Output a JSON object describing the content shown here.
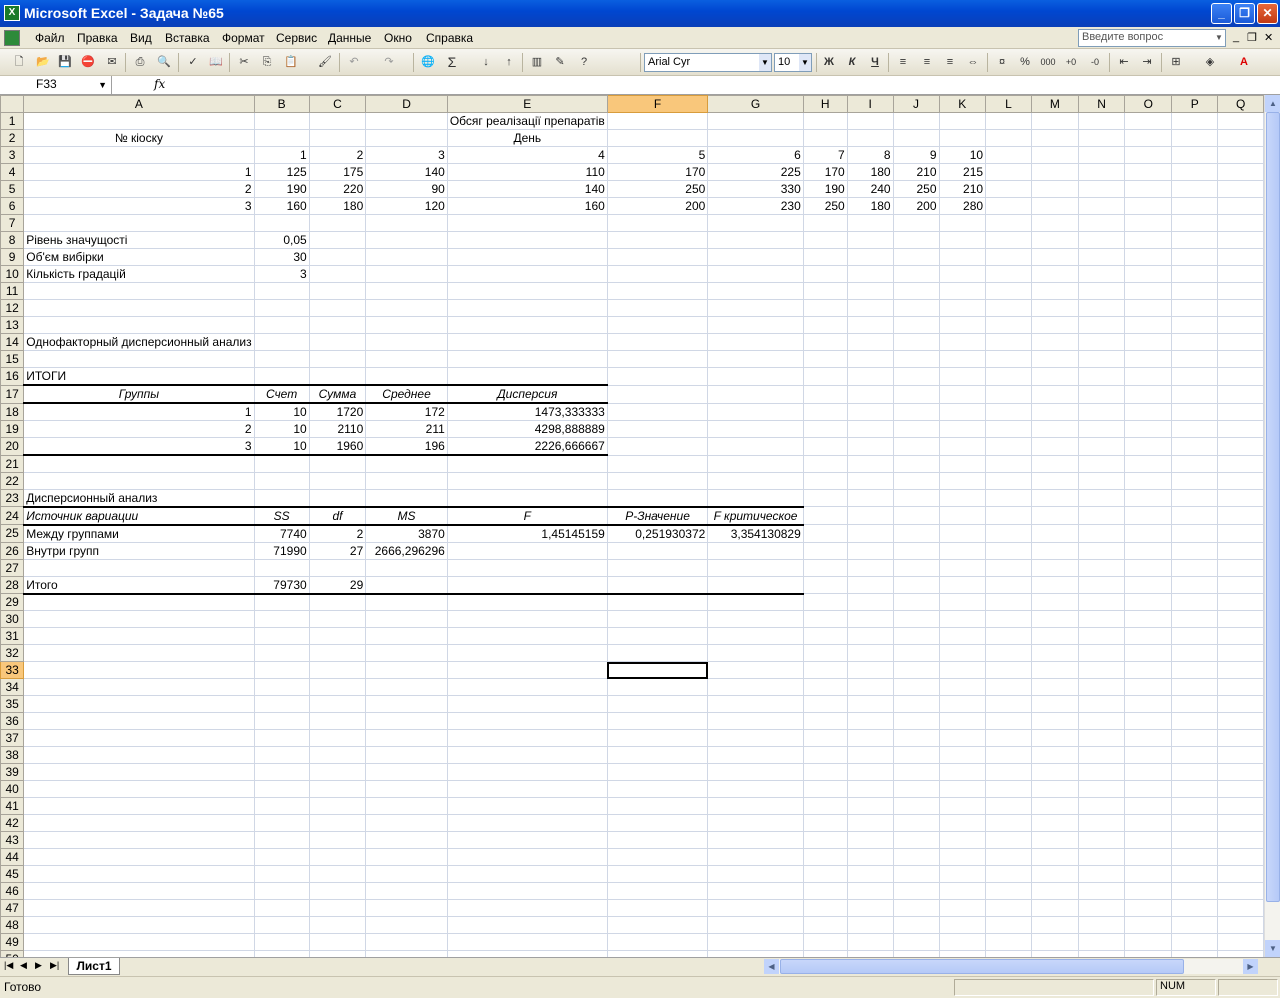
{
  "window": {
    "title": "Microsoft Excel - Задача №65",
    "minimize": "_",
    "restore": "❐",
    "close": "✕"
  },
  "menu": {
    "items": [
      "Файл",
      "Правка",
      "Вид",
      "Вставка",
      "Формат",
      "Сервис",
      "Данные",
      "Окно",
      "Справка"
    ],
    "ask_placeholder": "Введите вопрос"
  },
  "toolbar": {
    "font": "Arial Cyr",
    "size": "10",
    "bold": "Ж",
    "italic": "К",
    "underline": "Ч",
    "percent": "%",
    "thousands": "000",
    "sum": "Σ"
  },
  "formula": {
    "namebox": "F33",
    "fx": "fx",
    "value": ""
  },
  "columns": [
    "A",
    "B",
    "C",
    "D",
    "E",
    "F",
    "G",
    "H",
    "I",
    "J",
    "K",
    "L",
    "M",
    "N",
    "O",
    "P",
    "Q"
  ],
  "selected_column": "F",
  "selected_row": 33,
  "cells": {
    "E1": "Обсяг реалізації препаратів",
    "A2": "№ кіоску",
    "E2": "День",
    "B3": "1",
    "C3": "2",
    "D3": "3",
    "E3": "4",
    "F3": "5",
    "G3": "6",
    "H3": "7",
    "I3": "8",
    "J3": "9",
    "K3": "10",
    "A4": "1",
    "B4": "125",
    "C4": "175",
    "D4": "140",
    "E4": "110",
    "F4": "170",
    "G4": "225",
    "H4": "170",
    "I4": "180",
    "J4": "210",
    "K4": "215",
    "A5": "2",
    "B5": "190",
    "C5": "220",
    "D5": "90",
    "E5": "140",
    "F5": "250",
    "G5": "330",
    "H5": "190",
    "I5": "240",
    "J5": "250",
    "K5": "210",
    "A6": "3",
    "B6": "160",
    "C6": "180",
    "D6": "120",
    "E6": "160",
    "F6": "200",
    "G6": "230",
    "H6": "250",
    "I6": "180",
    "J6": "200",
    "K6": "280",
    "A8": "Рівень значущості",
    "B8": "0,05",
    "A9": "Об'єм вибірки",
    "B9": "30",
    "A10": "Кількість градацій",
    "B10": "3",
    "A14": "Однофакторный дисперсионный анализ",
    "A16": "ИТОГИ",
    "A17": "Группы",
    "B17": "Счет",
    "C17": "Сумма",
    "D17": "Среднее",
    "E17": "Дисперсия",
    "A18": "1",
    "B18": "10",
    "C18": "1720",
    "D18": "172",
    "E18": "1473,333333",
    "A19": "2",
    "B19": "10",
    "C19": "2110",
    "D19": "211",
    "E19": "4298,888889",
    "A20": "3",
    "B20": "10",
    "C20": "1960",
    "D20": "196",
    "E20": "2226,666667",
    "A23": "Дисперсионный анализ",
    "A24": "Источник вариации",
    "B24": "SS",
    "C24": "df",
    "D24": "MS",
    "E24": "F",
    "F24": "P-Значение",
    "G24": "F критическое",
    "A25": "Между группами",
    "B25": "7740",
    "C25": "2",
    "D25": "3870",
    "E25": "1,45145159",
    "F25": "0,251930372",
    "G25": "3,354130829",
    "A26": "Внутри групп",
    "B26": "71990",
    "C26": "27",
    "D26": "2666,296296",
    "A28": "Итого",
    "B28": "79730",
    "C28": "29"
  },
  "sheet_tab": "Лист1",
  "status": {
    "ready": "Готово",
    "num": "NUM"
  }
}
